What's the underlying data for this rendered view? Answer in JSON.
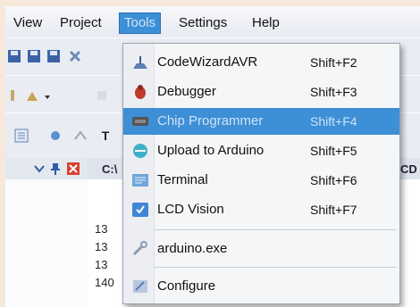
{
  "menubar": {
    "items": [
      {
        "label": "View",
        "ul": "V"
      },
      {
        "label": "Project",
        "ul": "P"
      },
      {
        "label": "Tools",
        "ul": "T",
        "active": true
      },
      {
        "label": "Settings",
        "ul": "S"
      },
      {
        "label": "Help",
        "ul": "H"
      }
    ]
  },
  "editor": {
    "tab_label": "C:\\",
    "tab_label_right": "CD",
    "line_numbers": [
      "13",
      "13",
      "13",
      "140"
    ]
  },
  "tools_menu": {
    "items": [
      {
        "label": "CodeWizardAVR",
        "shortcut": "Shift+F2",
        "icon": "codewizard-icon"
      },
      {
        "label": "Debugger",
        "shortcut": "Shift+F3",
        "icon": "bug-icon"
      },
      {
        "label": "Chip Programmer",
        "shortcut": "Shift+F4",
        "icon": "chip-icon",
        "highlighted": true
      },
      {
        "label": "Upload to Arduino",
        "shortcut": "Shift+F5",
        "icon": "arduino-icon"
      },
      {
        "label": "Terminal",
        "shortcut": "Shift+F6",
        "icon": "terminal-icon"
      },
      {
        "label": "LCD Vision",
        "shortcut": "Shift+F7",
        "icon": "lcd-icon"
      },
      {
        "label": "arduino.exe",
        "shortcut": "",
        "icon": "wrench-icon"
      },
      {
        "label": "Configure",
        "shortcut": "",
        "icon": "configure-icon"
      }
    ]
  },
  "colors": {
    "highlight": "#3d8fd6",
    "menu_bg": "#f5f6f8",
    "bg": "#f6e8da"
  }
}
